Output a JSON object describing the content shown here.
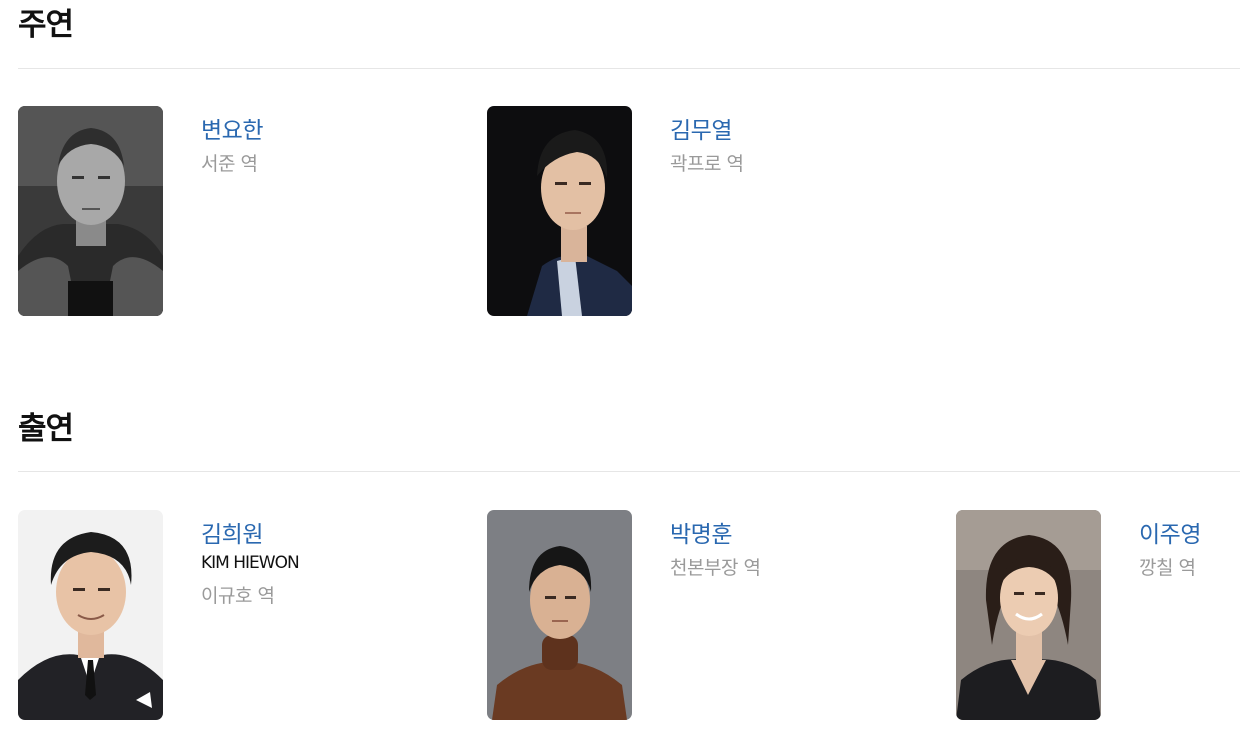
{
  "sections": {
    "lead": {
      "title": "주연",
      "cast": [
        {
          "name": "변요한",
          "role": "서준 역"
        },
        {
          "name": "김무열",
          "role": "곽프로 역"
        }
      ]
    },
    "supporting": {
      "title": "출연",
      "cast": [
        {
          "name": "김희원",
          "english_name": "KIM HIEWON",
          "role": "이규호 역"
        },
        {
          "name": "박명훈",
          "role": "천본부장 역"
        },
        {
          "name": "이주영",
          "role": "깡칠 역"
        }
      ]
    }
  },
  "colors": {
    "name_link": "#2a68b0",
    "role_text": "#9a9a9a",
    "heading": "#111111",
    "divider": "#e6e6e6"
  }
}
